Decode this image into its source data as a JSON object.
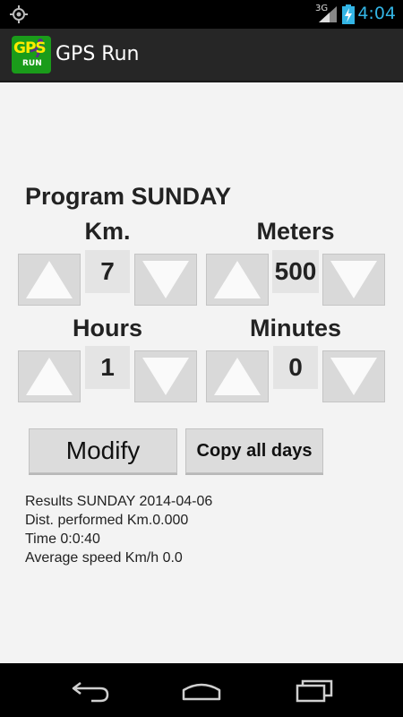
{
  "status_bar": {
    "network": "3G",
    "time": "4:04",
    "icons": [
      "gps-icon",
      "signal-icon",
      "battery-charging-icon"
    ]
  },
  "action_bar": {
    "app_title": "GPS Run",
    "logo_text_top": "GPS",
    "logo_text_bottom": "RUN"
  },
  "program": {
    "title": "Program SUNDAY",
    "km_label": "Km.",
    "meters_label": "Meters",
    "hours_label": "Hours",
    "minutes_label": "Minutes",
    "km_value": "7",
    "meters_value": "500",
    "hours_value": "1",
    "minutes_value": "0"
  },
  "buttons": {
    "modify": "Modify",
    "copy_all_days": "Copy all days"
  },
  "results": {
    "line1": "Results SUNDAY 2014-04-06",
    "line2": "Dist. performed Km.0.000",
    "line3": "Time 0:0:40",
    "line4": "Average speed Km/h 0.0"
  },
  "nav_bar": {
    "icons": [
      "back-icon",
      "home-icon",
      "recent-apps-icon"
    ]
  },
  "colors": {
    "status_accent": "#33b5e5",
    "action_bar_bg": "#262626",
    "button_bg": "#d9d9d9"
  }
}
